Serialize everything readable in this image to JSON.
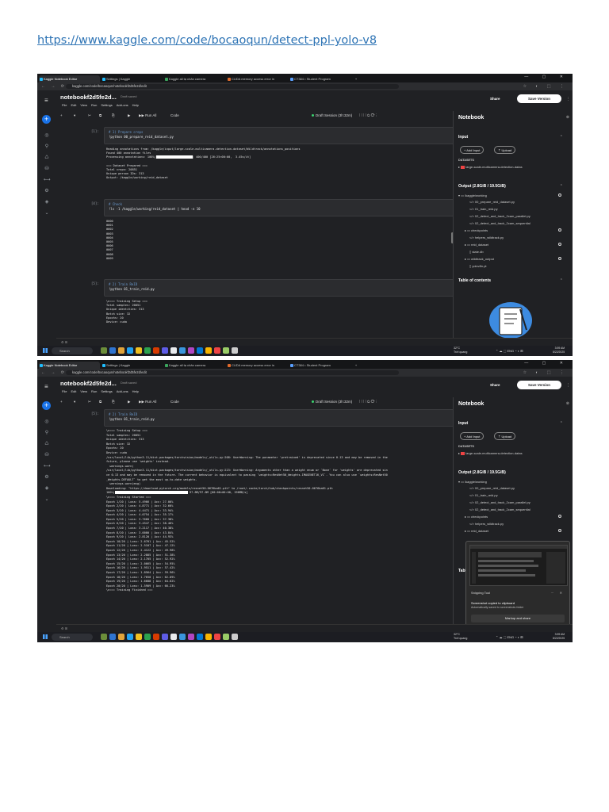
{
  "document": {
    "link_text": "https://www.kaggle.com/code/bocaoqun/detect-ppl-yolo-v8"
  },
  "browser": {
    "tabs": [
      "Kaggle Notebook Editor",
      "Settings | Kaggle",
      "Kaggle all tạ chân camera",
      "CUDA memory access error in",
      "CT384 • Student Program"
    ],
    "new_tab": "+",
    "window_controls": "— ▢ ✕",
    "nav_icons": "← → ⟳",
    "url": "kaggle.com/code/bocaoqun/notebookf2d5fe2d/edit",
    "ext_icons": "☆ ◐ ⬚ ⋮"
  },
  "kaggle": {
    "hamburger": "≡",
    "notebook_title": "notebookf2d5fe2d...",
    "draft_saved": "Draft saved",
    "menu": [
      "File",
      "Edit",
      "View",
      "Run",
      "Settings",
      "Add-ons",
      "Help"
    ],
    "share": "Share",
    "save_version": "Save Version",
    "kebab": "⋮",
    "toolbar": {
      "add": "+",
      "dropdown": "▾",
      "cut": "✂",
      "copy": "⧉",
      "paste": "⎘",
      "run": "▶",
      "run_all": "▶▶ Run All",
      "cell_type": "Code",
      "session": "Draft Session (3h:32m)",
      "right_icons": "⁞  ⁞  ⁞  ⁞  ⏻  ⟳  ⋮"
    },
    "rail_icons": [
      "+",
      "◎",
      "⚲",
      "♺",
      "⛁",
      "⟷",
      "⚙",
      "◈",
      "⌄"
    ],
    "status": "⚙  ⊞"
  },
  "shot1": {
    "cells": [
      {
        "label": "[1]:",
        "comment": "# 1) Prepare crops",
        "code": "!python 00_prepare_reid_dataset.py",
        "output": [
          "Reading annotations from: /kaggle/input/large-scale-multicamera-detection-dataset/Wildtrack/annotations_positions",
          "Found 400 annotation files",
          "Processing annotations: 100%|",
          "| 400/400 [26:25<00:00,  3.45s/it]",
          "",
          "=== Dataset Prepared ===",
          "Total crops: 20851",
          "Unique person IDs: 313",
          "Output: /kaggle/working/reid_dataset"
        ]
      },
      {
        "label": "[4]:",
        "comment": "# Check",
        "code": "!ls -1 /kaggle/working/reid_dataset | head -n 10",
        "output": [
          "0000",
          "0001",
          "0002",
          "0003",
          "0004",
          "0005",
          "0006",
          "0007",
          "0008",
          "0009"
        ]
      },
      {
        "label": "[5]:",
        "comment": "# 2) Train ReID",
        "code": "!python 01_train_reid.py",
        "output": [
          "\\n=== Training Setup ===",
          "Total samples: 20851",
          "Unique identities: 313",
          "Batch size: 32",
          "Epochs: 20",
          "Device: cuda"
        ]
      }
    ]
  },
  "shot2": {
    "cells": [
      {
        "label": "[5]:",
        "comment": "# 2) Train ReID",
        "code": "!python 01_train_reid.py",
        "output": [
          "\\n=== Training Setup ===",
          "Total samples: 20851",
          "Unique identities: 313",
          "Batch size: 32",
          "Epochs: 20",
          "Device: cuda",
          "/usr/local/lib/python3.11/dist-packages/torchvision/models/_utils.py:208: UserWarning: The parameter 'pretrained' is deprecated since 0.13 and may be removed in the",
          "future, please use 'weights' instead.",
          "  warnings.warn(",
          "/usr/local/lib/python3.11/dist-packages/torchvision/models/_utils.py:223: UserWarning: Arguments other than a weight enum or `None` for 'weights' are deprecated sin",
          "ce 0.13 and may be removed in the future. The current behavior is equivalent to passing `weights=ResNet50_Weights.IMAGENET1K_V1`. You can also use `weights=ResNet50",
          "_Weights.DEFAULT` to get the most up-to-date weights.",
          "  warnings.warn(msg)",
          "Downloading: \"https://download.pytorch.org/models/resnet50-0676ba61.pth\" to /root/.cache/torch/hub/checkpoints/resnet50-0676ba61.pth",
          "100%|",
          " 97.8M/97.8M [00:00<00:00, 196MB/s]",
          "\\n=== Training Started ===",
          "Epoch 1/20 | Loss: 5.4966 | Acc: 27.00%",
          "Epoch 2/20 | Loss: 4.8771 | Acc: 32.60%",
          "Epoch 3/20 | Loss: 4.4471 | Acc: 33.94%",
          "Epoch 4/20 | Loss: 4.0754 | Acc: 35.17%",
          "Epoch 5/20 | Loss: 3.7660 | Acc: 37.38%",
          "Epoch 6/20 | Loss: 3.4547 | Acc: 38.46%",
          "Epoch 7/20 | Loss: 3.2117 | Acc: 40.38%",
          "Epoch 8/20 | Loss: 3.0000 | Acc: 43.84%",
          "Epoch 9/20 | Loss: 2.8120 | Acc: 44.93%",
          "Epoch 10/20 | Loss: 2.6701 | Acc: 45.52%",
          "Epoch 11/20 | Loss: 2.5107 | Acc: 47.12%",
          "Epoch 12/20 | Loss: 2.4122 | Acc: 49.98%",
          "Epoch 13/20 | Loss: 2.2885 | Acc: 51.38%",
          "Epoch 14/20 | Loss: 2.1705 | Acc: 52.92%",
          "Epoch 15/20 | Loss: 2.0665 | Acc: 54.95%",
          "Epoch 16/20 | Loss: 1.9511 | Acc: 57.42%",
          "Epoch 17/20 | Loss: 1.8564 | Acc: 59.96%",
          "Epoch 18/20 | Loss: 1.7650 | Acc: 62.09%",
          "Epoch 19/20 | Loss: 1.6688 | Acc: 64.62%",
          "Epoch 20/20 | Loss: 1.5909 | Acc: 66.23%",
          "\\n=== Training Finished ===",
          "Checkpoints: /kaggle/working/checkpoints"
        ]
      }
    ]
  },
  "right_panel": {
    "title": "Notebook",
    "close": "⊗",
    "input_heading": "Input",
    "add_input": "+ Add Input",
    "upload": "⇡ Upload",
    "datasets_label": "DATASETS",
    "dataset_item": "large-scale-multicamera-detection-datas",
    "output_heading": "Output (2.8GiB / 19.5GiB)",
    "output_root": "/kaggle/working",
    "output_items": [
      "00_prepare_reid_dataset.py",
      "01_train_reid.py",
      "02_detect_and_track_2cam_parallel.py",
      "02_detect_and_track_2cam_sequential",
      "checkpoints",
      "helpers_wildtrack.py",
      "reid_dataset",
      "state.db",
      "wildtrack_output",
      "yolov8n.pt"
    ],
    "toc_heading": "Table of contents",
    "toc_cut": "Tabl"
  },
  "taskbar": {
    "search": "Search",
    "weather_temp": "32°C",
    "weather_desc": "Trời quang",
    "tray": "⌃  ☁  ⬚  ENG  ◔  ◐  ⊞",
    "time": "3:59 AM",
    "date": "8/22/2025"
  },
  "snipping": {
    "title": "Snipping Tool",
    "controls": "⋯ ✕",
    "message": "Screenshot copied to clipboard",
    "sub": "Automatically saved to screenshots folder",
    "button": "Markup and share"
  }
}
